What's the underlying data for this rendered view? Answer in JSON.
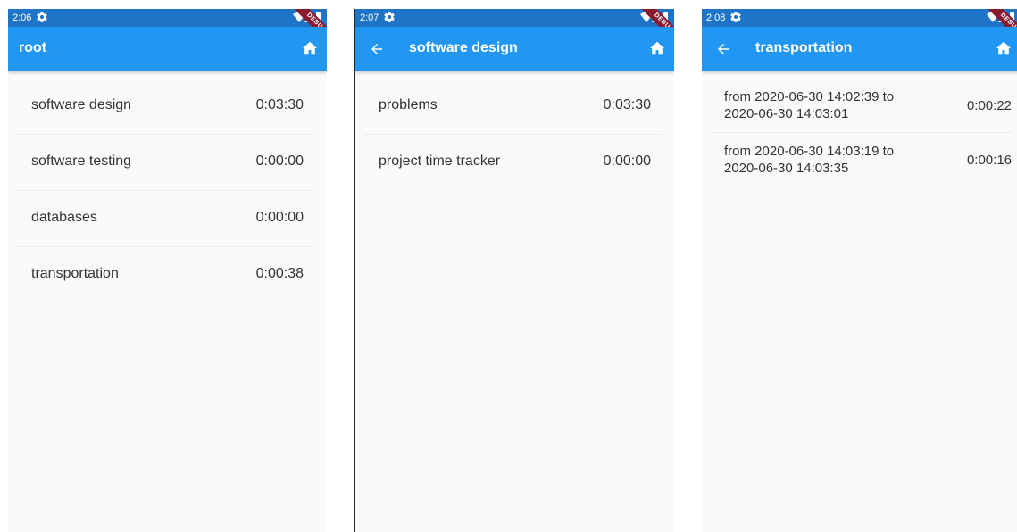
{
  "screens": [
    {
      "status": {
        "time": "2:06",
        "banner": "DEBUG"
      },
      "appbar": {
        "title": "root"
      },
      "items": [
        {
          "name": "software design",
          "duration": "0:03:30"
        },
        {
          "name": "software testing",
          "duration": "0:00:00"
        },
        {
          "name": "databases",
          "duration": "0:00:00"
        },
        {
          "name": "transportation",
          "duration": "0:00:38"
        }
      ]
    },
    {
      "status": {
        "time": "2:07",
        "banner": "DEBUG"
      },
      "appbar": {
        "title": "software design"
      },
      "items": [
        {
          "name": "problems",
          "duration": "0:03:30"
        },
        {
          "name": "project time tracker",
          "duration": "0:00:00"
        }
      ]
    },
    {
      "status": {
        "time": "2:08",
        "banner": "DEBUG"
      },
      "appbar": {
        "title": "transportation"
      },
      "intervals": [
        {
          "from_label": "from 2020-06-30 14:02:39 to",
          "to_label": "2020-06-30 14:03:01",
          "duration": "0:00:22"
        },
        {
          "from_label": "from 2020-06-30 14:03:19 to",
          "to_label": "2020-06-30 14:03:35",
          "duration": "0:00:16"
        }
      ]
    }
  ],
  "colors": {
    "appbar": "#2196f3",
    "statusbar": "#1e74c6",
    "debug_banner": "#8a1a2d"
  },
  "icons": {
    "status": [
      "gear-icon",
      "wifi-icon",
      "signal-icon",
      "battery-icon"
    ],
    "appbar": [
      "back-arrow-icon",
      "home-icon"
    ]
  }
}
